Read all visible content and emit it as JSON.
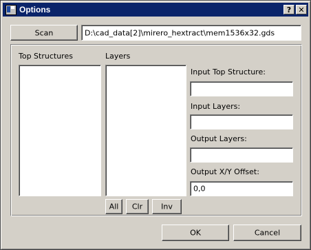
{
  "window": {
    "title": "Options",
    "help_label": "?",
    "close_label": "✕"
  },
  "scan": {
    "button_label": "Scan",
    "path_value": "D:\\cad_data[2]\\mirero_hextract\\mem1536x32.gds"
  },
  "lists": {
    "top_structures_label": "Top Structures",
    "layers_label": "Layers"
  },
  "layer_buttons": {
    "all_label": "All",
    "clr_label": "Clr",
    "inv_label": "Inv"
  },
  "inputs": {
    "input_top_structure_label": "Input Top Structure:",
    "input_top_structure_value": "",
    "input_layers_label": "Input Layers:",
    "input_layers_value": "",
    "output_layers_label": "Output Layers:",
    "output_layers_value": "",
    "output_offset_label": "Output X/Y Offset:",
    "output_offset_value": "0,0"
  },
  "footer": {
    "ok_label": "OK",
    "cancel_label": "Cancel"
  }
}
